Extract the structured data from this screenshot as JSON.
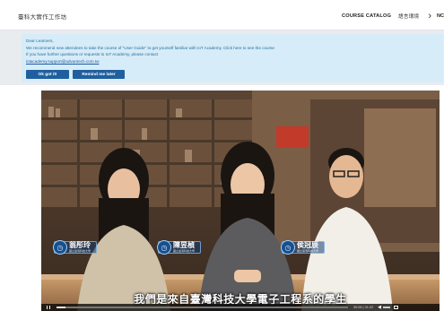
{
  "header": {
    "site_title": "臺科大實作工作坊",
    "nav": {
      "course_catalog": "COURSE CATALOG",
      "lang_link": "語言環境",
      "cut_label": "NC"
    }
  },
  "notice": {
    "line1": "Dear Learners,",
    "line2": "We recommend new attendees to take the course of \"User Guide\" to get yourself familiar with IoT Academy. Click here to see the course",
    "line3": "If you have further questions or requests to IoT Academy, please contact",
    "email": "iotacademy.support@advantech.com.tw",
    "ok_label": "Ok got it!",
    "later_label": "Remind me later"
  },
  "video": {
    "subtitle": "我們是來自臺灣科技大學電子工程系的學生",
    "name_tags": [
      {
        "name": "翁彤玲",
        "sub": "國立臺灣科技大學"
      },
      {
        "name": "陳昱楨",
        "sub": "國立臺灣科技大學"
      },
      {
        "name": "侯冠辰",
        "sub": "國立臺灣科技大學"
      }
    ],
    "progress": 0.03,
    "time_text": "00:06 | 01:22"
  },
  "colors": {
    "notice_bg": "#d6ecf8",
    "button_bg": "#1f5f9e",
    "notice_text": "#2a6f9b"
  }
}
